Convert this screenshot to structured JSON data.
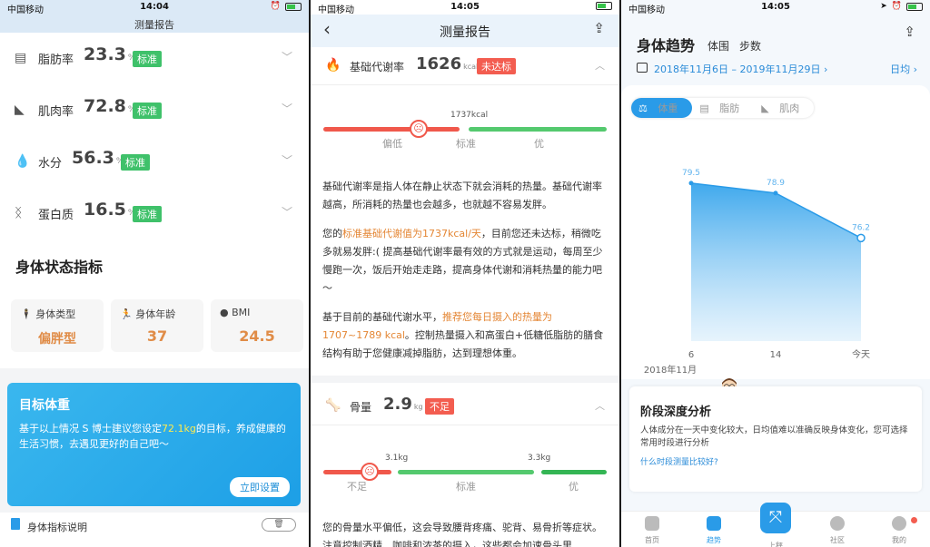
{
  "screen1": {
    "status": {
      "carrier": "中国移动",
      "time": "14:04"
    },
    "title": "测量报告",
    "metrics": [
      {
        "label": "脂肪率",
        "value": "23.3",
        "unit": "%",
        "badge": "标准",
        "icon": "fat-icon"
      },
      {
        "label": "肌肉率",
        "value": "72.8",
        "unit": "%",
        "badge": "标准",
        "icon": "muscle-icon"
      },
      {
        "label": "水分",
        "value": "56.3",
        "unit": "%",
        "badge": "标准",
        "icon": "water-drop-icon"
      },
      {
        "label": "蛋白质",
        "value": "16.5",
        "unit": "%",
        "badge": "标准",
        "icon": "protein-icon"
      }
    ],
    "section_title": "身体状态指标",
    "tiles": [
      {
        "label": "身体类型",
        "value": "偏胖型"
      },
      {
        "label": "身体年龄",
        "value": "37"
      },
      {
        "label": "BMI",
        "value": "24.5"
      }
    ],
    "target": {
      "title": "目标体重",
      "desc_pre": "基于以上情况 S 博士建议您设定",
      "desc_hl": "72.1kg",
      "desc_post": "的目标，养成健康的生活习惯，去遇见更好的自己吧～",
      "button": "立即设置"
    },
    "footer": {
      "label": "身体指标说明"
    },
    "colors": {
      "accent": "#2a9be8",
      "good": "#3fc16a",
      "warn": "#e08c47"
    }
  },
  "screen2": {
    "status": {
      "carrier": "中国移动",
      "time": "14:05"
    },
    "title": "测量报告",
    "bmr": {
      "label": "基础代谢率",
      "value": "1626",
      "unit": "kcal",
      "badge": "未达标",
      "scale_tick": "1737kcal",
      "scale_labels": [
        "偏低",
        "标准",
        "优"
      ]
    },
    "bmr_para1": "基础代谢率是指人体在静止状态下就会消耗的热量。基础代谢率越高，所消耗的热量也会越多，也就越不容易发胖。",
    "bmr_para2_pre": "您的",
    "bmr_para2_hl": "标准基础代谢值为1737kcal/天",
    "bmr_para2_post": "，目前您还未达标，稍微吃多就易发胖:( 提高基础代谢率最有效的方式就是运动，每周至少慢跑一次，饭后开始走走路，提高身体代谢和消耗热量的能力吧～",
    "bmr_para3_pre": "基于目前的基础代谢水平，",
    "bmr_para3_hl": "推荐您每日摄入的热量为1707~1789 kcal",
    "bmr_para3_post": "。控制热量摄入和高蛋白+低糖低脂肪的膳食结构有助于您健康减掉脂肪，达到理想体重。",
    "bone": {
      "label": "骨量",
      "value": "2.9",
      "unit": "kg",
      "badge": "不足",
      "scale_ticks": [
        "3.1kg",
        "3.3kg"
      ],
      "scale_labels": [
        "不足",
        "标准",
        "优"
      ]
    },
    "bone_para": "您的骨量水平偏低，这会导致腰背疼痛、驼背、易骨折等症状。注意控制酒精、咖啡和浓茶的摄入，这些都会加速骨头里"
  },
  "screen3": {
    "status": {
      "carrier": "中国移动",
      "time": "14:05"
    },
    "title": "身体趋势",
    "subtabs": [
      "体围",
      "步数"
    ],
    "date_range": "2018年11月6日 – 2019年11月29日 ›",
    "avg_label": "日均 ›",
    "seg": [
      "体重",
      "脂肪",
      "肌肉"
    ],
    "chart_data": {
      "type": "area",
      "x": [
        "6",
        "14",
        "今天"
      ],
      "values": [
        79.5,
        78.9,
        76.2
      ],
      "xlabel": "2018年11月",
      "ylim": [
        70,
        82
      ]
    },
    "analysis": {
      "title": "阶段深度分析",
      "desc": "人体成分在一天中变化较大，日均值难以准确反映身体变化，您可选择常用时段进行分析",
      "link": "什么时段测量比较好?"
    },
    "tabbar": [
      "首页",
      "趋势",
      "上秤",
      "社区",
      "我的"
    ]
  }
}
